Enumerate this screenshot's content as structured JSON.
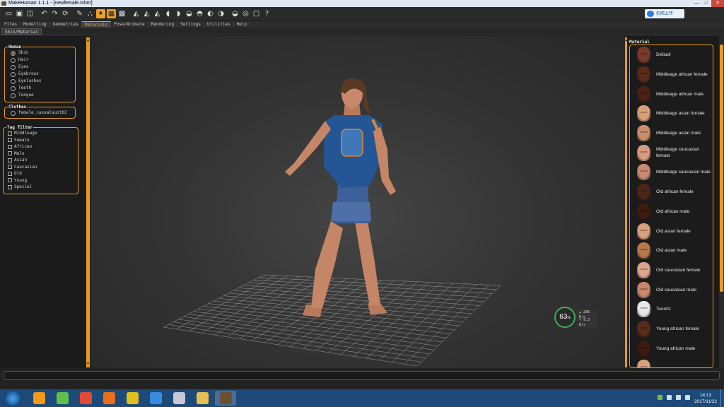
{
  "window": {
    "title": "MakeHuman 1.1.1 - [newfemale.mhm]",
    "controls": [
      "—",
      "□",
      "✕"
    ]
  },
  "toolbar": {
    "icons": [
      "window-icon",
      "save-icon",
      "export-icon",
      "undo-icon",
      "redo-icon",
      "reset-icon",
      "wireframe-icon",
      "smooth-icon",
      "pose-icon",
      "skeleton-icon",
      "subdivide-icon",
      "front-view-icon",
      "back-view-icon",
      "left-view-icon",
      "right-view-icon",
      "top-view-icon",
      "bottom-view-icon",
      "reset-camera-icon",
      "screenshot-icon",
      "help-icon"
    ],
    "glyphs": [
      "▭",
      "▣",
      "◫",
      "↶",
      "↷",
      "⟳",
      "✎",
      "⛬",
      "✦",
      "▦",
      "▩",
      "◭",
      "◭",
      "◭",
      "◖",
      "◗",
      "◒",
      "◓",
      "◐",
      "◑",
      "◒",
      "◎",
      "▢",
      "?"
    ],
    "cloud_label": "拍照上传"
  },
  "tabs": [
    "Files",
    "Modelling",
    "Geometries",
    "Materials",
    "Pose/Animate",
    "Rendering",
    "Settings",
    "Utilities",
    "Help"
  ],
  "active_tab": "Materials",
  "subtab": "Skin/Material",
  "human": {
    "title": "Human",
    "options": [
      "Skin",
      "Hair",
      "Eyes",
      "Eyebrows",
      "Eyelashes",
      "Teeth",
      "Tongue"
    ],
    "selected": "Skin"
  },
  "clothes": {
    "title": "Clothes",
    "options": [
      "female_casualsuit02"
    ]
  },
  "tag_filter": {
    "title": "Tag filter",
    "tags": [
      "Middleage",
      "Female",
      "African",
      "Male",
      "Asian",
      "Caucasian",
      "Old",
      "Young",
      "Special"
    ]
  },
  "material": {
    "title": "Material",
    "items": [
      {
        "label": "Default",
        "skin": "#7a3a2a"
      },
      {
        "label": "Middleage african female",
        "skin": "#5a2a1a"
      },
      {
        "label": "Middleage african male",
        "skin": "#4a2214"
      },
      {
        "label": "Middleage asian female",
        "skin": "#d8a07a"
      },
      {
        "label": "Middleage asian male",
        "skin": "#c8906a"
      },
      {
        "label": "Middleage caucasian female",
        "skin": "#d89a80"
      },
      {
        "label": "Middleage caucasian male",
        "skin": "#c88a70"
      },
      {
        "label": "Old african female",
        "skin": "#4e2616"
      },
      {
        "label": "Old african male",
        "skin": "#3e1c10"
      },
      {
        "label": "Old asian female",
        "skin": "#d8a07c"
      },
      {
        "label": "Old asian male",
        "skin": "#b8784c"
      },
      {
        "label": "Old caucasian female",
        "skin": "#dca58e"
      },
      {
        "label": "Old caucasian male",
        "skin": "#c8866a"
      },
      {
        "label": "Toon01",
        "skin": "#e8e8e8"
      },
      {
        "label": "Young african female",
        "skin": "#5c2c1a"
      },
      {
        "label": "Young african male",
        "skin": "#3c1a0e"
      },
      {
        "label": "",
        "skin": "#d8a07a"
      }
    ]
  },
  "perf": {
    "percent": "63",
    "unit": "%",
    "up": "296",
    "up_unit": "K/s",
    "down": "9.3",
    "down_unit": "K/s"
  },
  "taskbar": {
    "apps": [
      {
        "name": "sublime-icon",
        "color": "#f29a1c",
        "active": false
      },
      {
        "name": "wechat-icon",
        "color": "#5fbf4a",
        "active": false
      },
      {
        "name": "chrome-icon",
        "color": "#e24a3a",
        "active": false
      },
      {
        "name": "firefox-icon",
        "color": "#e8701c",
        "active": false
      },
      {
        "name": "app-yellow-icon",
        "color": "#e0c020",
        "active": false
      },
      {
        "name": "baidu-cloud-icon",
        "color": "#3a8ae0",
        "active": false
      },
      {
        "name": "paint-icon",
        "color": "#c8c8d8",
        "active": false
      },
      {
        "name": "folder-icon",
        "color": "#e8c050",
        "active": false
      },
      {
        "name": "makehuman-icon",
        "color": "#6a5030",
        "active": true
      }
    ],
    "time": "14:13",
    "date": "2017/11/22"
  },
  "colors": {
    "accent": "#e89a1c",
    "panel": "#1b1b1b",
    "viewport": "#353535"
  }
}
